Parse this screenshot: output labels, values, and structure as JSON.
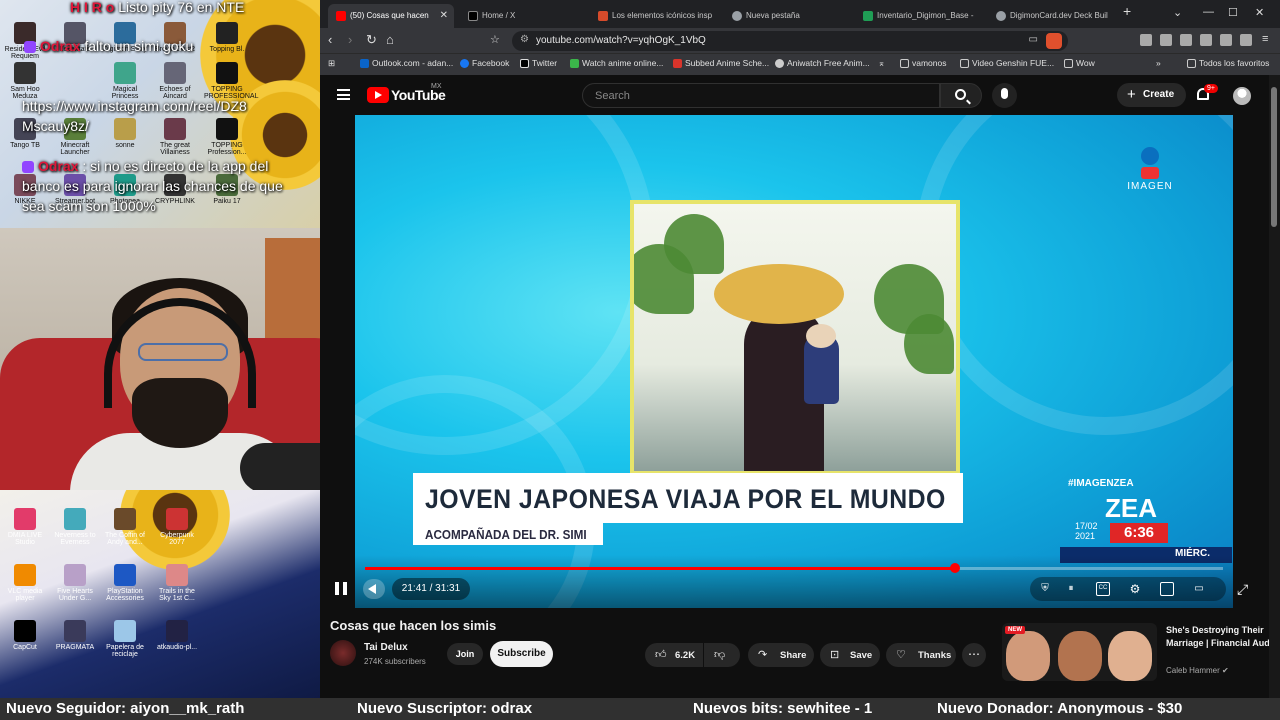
{
  "overlay": {
    "chat": [
      {
        "user": "H I R o",
        "message": "Listo pity 76 en NTE"
      },
      {
        "user": "Odrax",
        "message": "falto un simi goku"
      },
      {
        "user": "Odrax",
        "message": "https://www.instagram.com/reel/DZ8 Mscauy8z/"
      },
      {
        "user": "Odrax",
        "message": ": si no es directo de la app del banco es para ignorar las chances de que sea scam son 1000%"
      }
    ],
    "desktop_icons_top": [
      "Resident Evil Requiem",
      "Levantate",
      "Digimon Story",
      "Brown Dust2",
      "Topping Bl.",
      "Sam Hoo Meduza",
      "Magical Princess",
      "Echoes of Aincard",
      "TOPPING PROFESSIONAL",
      "Tango TB",
      "Minecraft Launcher",
      "sonne",
      "The great Villainess",
      "TOPPING Profession...",
      "NIKKE",
      "Streamer.bot",
      "Photopea",
      "CRYPHLINK",
      "Paiku 17"
    ],
    "desktop_icons_bottom": [
      "DMIA LIVE Studio",
      "Neverness to Everness",
      "The Coffin of Andy and...",
      "Cyberpunk 2077",
      "VLC media player",
      "Five Hearts Under G...",
      "PlayStation Accessories",
      "Trails in the Sky 1st C...",
      "CapCut",
      "PRAGMATA",
      "Papelera de reciclaje",
      "atkaudio-pl..."
    ]
  },
  "browser": {
    "tabs": [
      {
        "label": "(50) Cosas que hacen",
        "active": true,
        "fav_color": "#ff0000"
      },
      {
        "label": "Home / X",
        "active": false,
        "fav_color": "#000000"
      },
      {
        "label": "Los elementos icónicos insp",
        "active": false,
        "fav_color": "#d64b2b"
      },
      {
        "label": "Nueva pestaña",
        "active": false,
        "fav_color": "#9aa0a6"
      },
      {
        "label": "Inventario_Digimon_Base - ",
        "active": false,
        "fav_color": "#1f9d55"
      },
      {
        "label": "DigimonCard.dev Deck Buil",
        "active": false,
        "fav_color": "#9aa0a6"
      }
    ],
    "new_tab": "+",
    "url": "youtube.com/watch?v=yqhOgK_1VbQ",
    "bookmarks": [
      {
        "label": "Outlook.com - adan...",
        "color": "#0a64c8"
      },
      {
        "label": "Facebook",
        "color": "#1877f2"
      },
      {
        "label": "Twitter",
        "color": "#ffffff"
      },
      {
        "label": "Watch anime online...",
        "color": "#3bb54a"
      },
      {
        "label": "Subbed Anime Sche...",
        "color": "#d9342b"
      },
      {
        "label": "Aniwatch Free Anim...",
        "color": "#cccccc"
      },
      {
        "label": "vamonos",
        "color": "#aaaaaa"
      },
      {
        "label": "Video Genshin FUE...",
        "color": "#aaaaaa"
      },
      {
        "label": "Wow",
        "color": "#aaaaaa"
      }
    ],
    "bookmarks_overflow": "»",
    "all_favorites": "Todos los favoritos"
  },
  "youtube": {
    "logo": "YouTube",
    "country_code": "MX",
    "search_placeholder": "Search",
    "create_label": "Create",
    "notification_count": "9+",
    "video": {
      "title": "Cosas que hacen los simis",
      "current_time": "21:41",
      "duration": "31:31",
      "time_display": "21:41 / 31:31",
      "progress_fraction": 0.688,
      "headline": "JOVEN JAPONESA VIAJA POR EL MUNDO",
      "subheadline": "ACOMPAÑADA DEL DR. SIMI",
      "network_logo": "IMAGEN",
      "hashtag": "#IMAGENZEA",
      "show_name": "ZEA",
      "show_date": "17/02 2021",
      "show_time": "6:36",
      "show_day": "MIÉRC."
    },
    "channel": {
      "name": "Tai Delux",
      "subscribers": "274K subscribers",
      "join_label": "Join",
      "subscribe_label": "Subscribe"
    },
    "actions": {
      "likes": "6.2K",
      "share_label": "Share",
      "save_label": "Save",
      "thanks_label": "Thanks"
    },
    "recommendation": {
      "badge": "NEW",
      "title": "She's Destroying Their Marriage | Financial Audit",
      "channel": "Caleb Hammer"
    }
  },
  "ticker": {
    "items": [
      "Nuevo Seguidor: aiyon__mk_rath",
      "Nuevo Suscriptor: odrax",
      "Nuevos bits: sewhitee - 1",
      "Nuevo Donador: Anonymous - $30"
    ]
  }
}
